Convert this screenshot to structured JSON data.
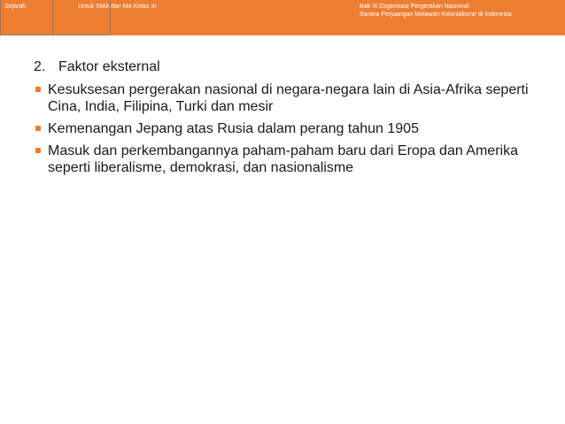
{
  "header": {
    "subject": "Sejarah",
    "grade": "Untuk SMA dan MA Kelas XI",
    "chapter_line1": "Bab III Organisasi Pergerakan Nasional:",
    "chapter_line2": "Sarana Perjuangan Melawan Kolonialisme di Indonesia"
  },
  "colors": {
    "header_bg": "#ed7d31",
    "bullet": "#ed7d31"
  },
  "section": {
    "number": "2.",
    "title": "Faktor eksternal",
    "bullet_icon": "square-bullet-icon",
    "items": [
      {
        "text": "Kesuksesan pergerakan nasional di negara-negara lain di Asia-Afrika seperti Cina, India, Filipina, Turki dan mesir"
      },
      {
        "text": "Kemenangan Jepang atas Rusia dalam perang tahun 1905"
      },
      {
        "text": "Masuk dan perkembangannya paham-paham baru dari Eropa dan Amerika seperti liberalisme, demokrasi, dan nasionalisme"
      }
    ]
  }
}
